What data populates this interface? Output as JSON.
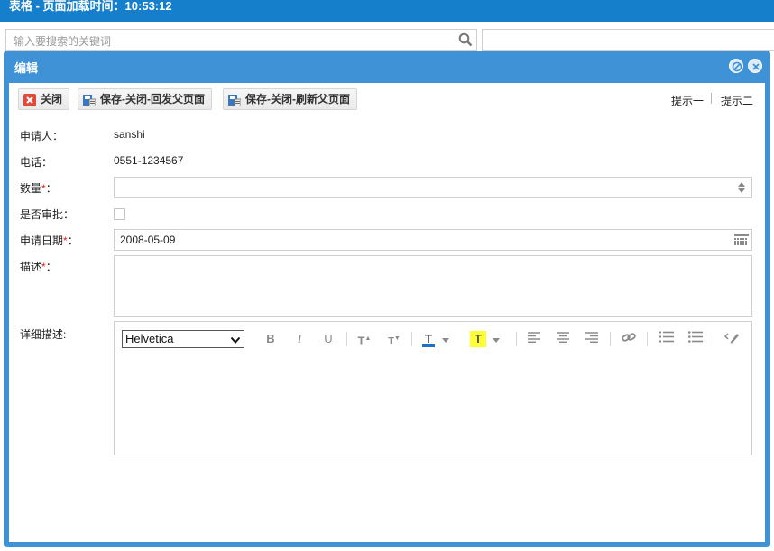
{
  "page": {
    "header_title": "表格 - 页面加载时间：10:53:12",
    "search_placeholder": "输入要搜索的关键词"
  },
  "window": {
    "title": "编辑",
    "toolbar": {
      "close_label": "关闭",
      "save_close_back_label": "保存-关闭-回发父页面",
      "save_close_refresh_label": "保存-关闭-刷新父页面",
      "hint1": "提示一",
      "hint2": "提示二"
    },
    "form": {
      "applicant_label": "申请人：",
      "applicant_value": "sanshi",
      "phone_label": "电话：",
      "phone_value": "0551-1234567",
      "quantity_label": "数量",
      "approve_label": "是否审批：",
      "apply_date_label": "申请日期",
      "apply_date_value": "2008-05-09",
      "desc_label": "描述",
      "detail_label": "详细描述:",
      "required_mark": "*",
      "colon": "："
    },
    "editor": {
      "font_value": "Helvetica",
      "bold": "B",
      "italic": "I",
      "underline": "U",
      "superscript": "T",
      "subscript": "T",
      "font_color": "T",
      "bg_color": "T"
    }
  },
  "colors": {
    "header_blue": "#157fcc",
    "window_blue": "#3f92d6",
    "required_red": "#e02020",
    "highlight_yellow": "#ffff33",
    "font_color_bar": "#1f6fc4"
  }
}
